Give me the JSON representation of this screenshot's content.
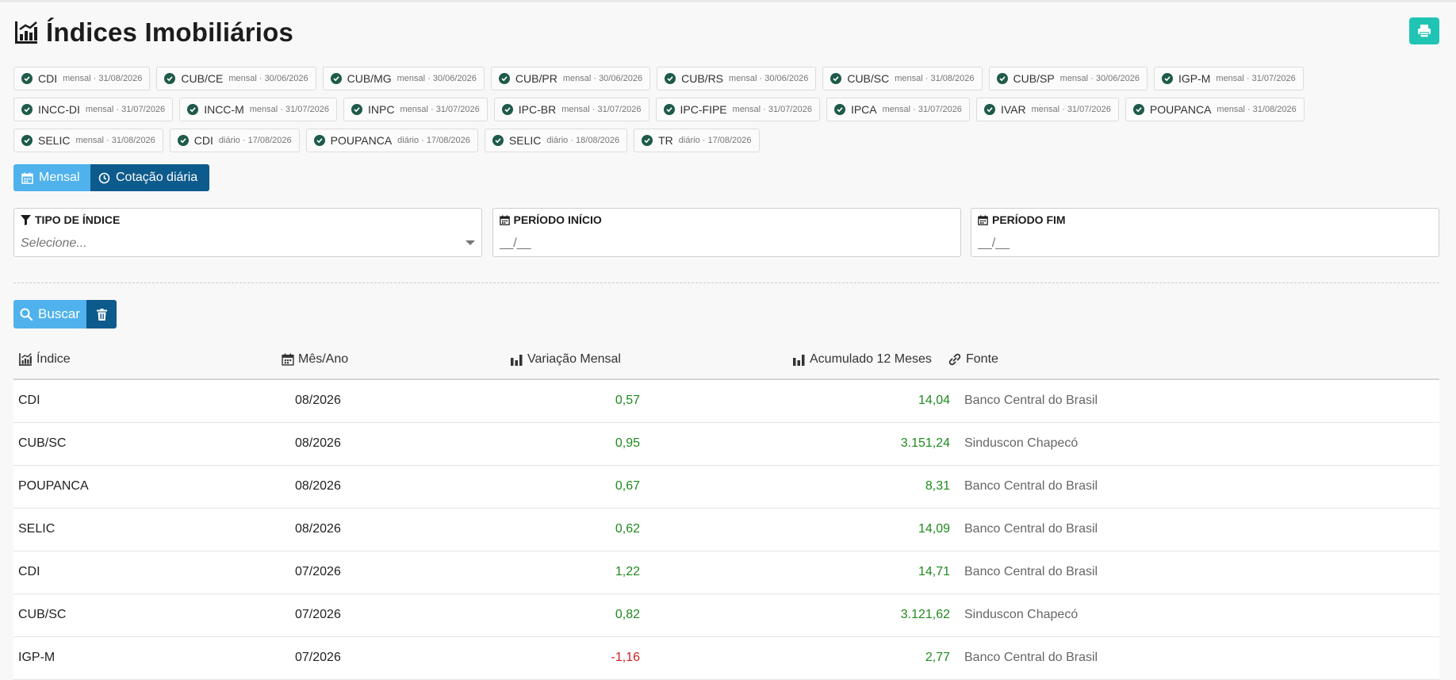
{
  "header": {
    "title": "Índices Imobiliários"
  },
  "chips": [
    [
      {
        "name": "CDI",
        "meta": "mensal · 31/08/2026"
      },
      {
        "name": "CUB/CE",
        "meta": "mensal · 30/06/2026"
      },
      {
        "name": "CUB/MG",
        "meta": "mensal · 30/06/2026"
      },
      {
        "name": "CUB/PR",
        "meta": "mensal · 30/06/2026"
      },
      {
        "name": "CUB/RS",
        "meta": "mensal · 30/06/2026"
      },
      {
        "name": "CUB/SC",
        "meta": "mensal · 31/08/2026"
      },
      {
        "name": "CUB/SP",
        "meta": "mensal · 30/06/2026"
      },
      {
        "name": "IGP-M",
        "meta": "mensal · 31/07/2026"
      }
    ],
    [
      {
        "name": "INCC-DI",
        "meta": "mensal · 31/07/2026"
      },
      {
        "name": "INCC-M",
        "meta": "mensal · 31/07/2026"
      },
      {
        "name": "INPC",
        "meta": "mensal · 31/07/2026"
      },
      {
        "name": "IPC-BR",
        "meta": "mensal · 31/07/2026"
      },
      {
        "name": "IPC-FIPE",
        "meta": "mensal · 31/07/2026"
      },
      {
        "name": "IPCA",
        "meta": "mensal · 31/07/2026"
      },
      {
        "name": "IVAR",
        "meta": "mensal · 31/07/2026"
      },
      {
        "name": "POUPANCA",
        "meta": "mensal · 31/08/2026"
      }
    ],
    [
      {
        "name": "SELIC",
        "meta": "mensal · 31/08/2026"
      },
      {
        "name": "CDI",
        "meta": "diário · 17/08/2026"
      },
      {
        "name": "POUPANCA",
        "meta": "diário · 17/08/2026"
      },
      {
        "name": "SELIC",
        "meta": "diário · 18/08/2026"
      },
      {
        "name": "TR",
        "meta": "diário · 17/08/2026"
      }
    ]
  ],
  "tabs": {
    "mensal": "Mensal",
    "diaria": "Cotação diária"
  },
  "filters": {
    "tipo": {
      "label": "TIPO DE ÍNDICE",
      "placeholder": "Selecione..."
    },
    "inicio": {
      "label": "PERÍODO INÍCIO",
      "placeholder": "__/__"
    },
    "fim": {
      "label": "PERÍODO FIM",
      "placeholder": "__/__"
    }
  },
  "actions": {
    "buscar": "Buscar"
  },
  "table": {
    "headers": {
      "indice": "Índice",
      "mes": "Mês/Ano",
      "variacao": "Variação Mensal",
      "acumulado": "Acumulado 12 Meses",
      "fonte": "Fonte"
    },
    "rows": [
      {
        "indice": "CDI",
        "mes": "08/2026",
        "variacao": "0,57",
        "acumulado": "14,04",
        "fonte": "Banco Central do Brasil",
        "sign": "pos"
      },
      {
        "indice": "CUB/SC",
        "mes": "08/2026",
        "variacao": "0,95",
        "acumulado": "3.151,24",
        "fonte": "Sinduscon Chapecó",
        "sign": "pos"
      },
      {
        "indice": "POUPANCA",
        "mes": "08/2026",
        "variacao": "0,67",
        "acumulado": "8,31",
        "fonte": "Banco Central do Brasil",
        "sign": "pos"
      },
      {
        "indice": "SELIC",
        "mes": "08/2026",
        "variacao": "0,62",
        "acumulado": "14,09",
        "fonte": "Banco Central do Brasil",
        "sign": "pos"
      },
      {
        "indice": "CDI",
        "mes": "07/2026",
        "variacao": "1,22",
        "acumulado": "14,71",
        "fonte": "Banco Central do Brasil",
        "sign": "pos"
      },
      {
        "indice": "CUB/SC",
        "mes": "07/2026",
        "variacao": "0,82",
        "acumulado": "3.121,62",
        "fonte": "Sinduscon Chapecó",
        "sign": "pos"
      },
      {
        "indice": "IGP-M",
        "mes": "07/2026",
        "variacao": "-1,16",
        "acumulado": "2,77",
        "fonte": "Banco Central do Brasil",
        "sign": "neg"
      }
    ]
  },
  "colors": {
    "accent_light": "#4fb2ec",
    "accent_dark": "#0d5a8c",
    "print_teal": "#20c4b4",
    "positive": "#1e8a1e",
    "negative": "#d42020",
    "check": "#1e5a4a"
  }
}
